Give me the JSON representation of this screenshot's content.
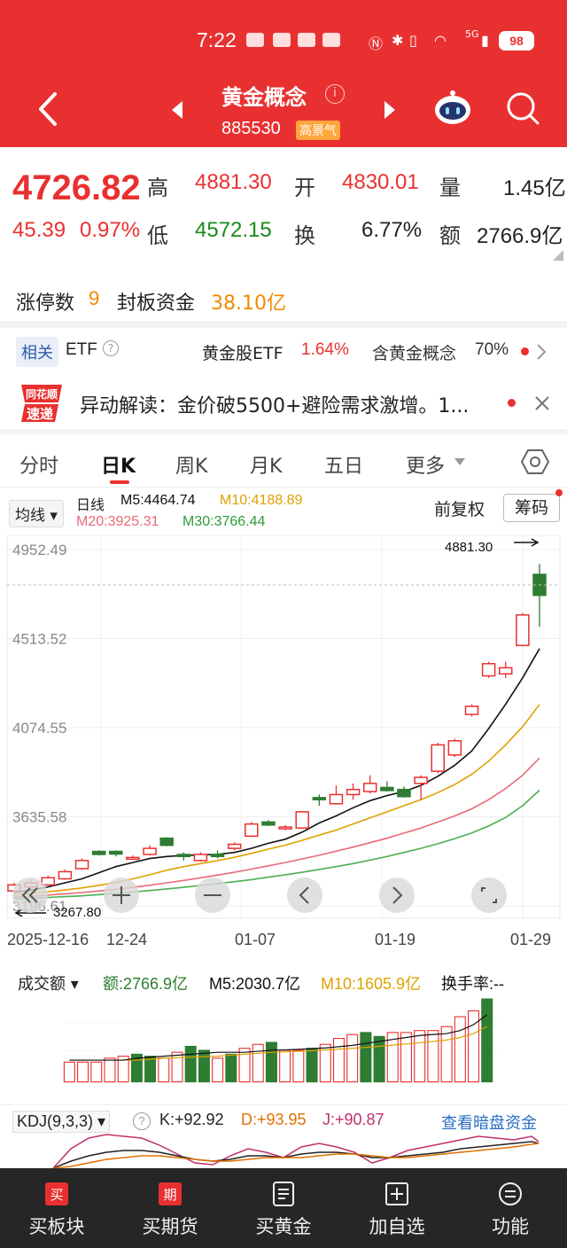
{
  "status_bar": {
    "time": "7:22",
    "signal": "5G",
    "battery": "98"
  },
  "header": {
    "title": "黄金概念",
    "code": "885530",
    "badge": "高景气"
  },
  "quote": {
    "price": "4726.82",
    "change": "45.39",
    "change_pct": "0.97%",
    "labels": {
      "high": "高",
      "low": "低",
      "open": "开",
      "turnover": "换",
      "volume": "量",
      "amount": "额"
    },
    "high": "4881.30",
    "low": "4572.15",
    "open": "4830.01",
    "turnover_rate": "6.77%",
    "volume": "1.45亿",
    "amount": "2766.9亿"
  },
  "limit_up": {
    "label": "涨停数",
    "count": "9",
    "seal_label": "封板资金",
    "seal_amount": "38.10亿"
  },
  "related": {
    "tag": "相关",
    "etf": "ETF",
    "gold_etf_name": "黄金股ETF",
    "gold_etf_pct": "1.64%",
    "contain_label": "含黄金概念",
    "contain_pct": "70%"
  },
  "news": {
    "logo_line1": "同花顺",
    "logo_line2": "速递",
    "text": "异动解读：金价破5500+避险需求激增。1..."
  },
  "tabs": [
    "分时",
    "日K",
    "周K",
    "月K",
    "五日",
    "更多"
  ],
  "ma": {
    "select": "均线",
    "kind": "日线",
    "m5": "M5:4464.74",
    "m10": "M10:4188.89",
    "m20": "M20:3925.31",
    "m30": "M30:3766.44",
    "adjust": "前复权",
    "chip_button": "筹码"
  },
  "price_axis": [
    "4952.49",
    "4513.52",
    "4074.55",
    "3635.58",
    "3196.61"
  ],
  "chart_high_label": "4881.30",
  "chart_low_label": "3267.80",
  "date_axis": [
    "2025-12-16",
    "12-24",
    "01-07",
    "01-19",
    "01-29"
  ],
  "volume_header": {
    "select": "成交额",
    "amount": "额:2766.9亿",
    "m5": "M5:2030.7亿",
    "m10": "M10:1605.9亿",
    "turnover": "换手率:--"
  },
  "kdj_header": {
    "select": "KDJ(9,3,3)",
    "k": "K:+92.92",
    "d": "D:+93.95",
    "j": "J:+90.87",
    "link": "查看暗盘资金"
  },
  "bottom_nav": [
    "买板块",
    "买期货",
    "买黄金",
    "加自选",
    "功能"
  ],
  "colors": {
    "red": "#e93030",
    "green": "#2e7d32",
    "ma5": "#111111",
    "ma10": "#e0a000",
    "ma20": "#e86a78",
    "ma30": "#4caf50"
  },
  "chart_data": {
    "type": "candlestick",
    "ylim": [
      3196.61,
      4952.49
    ],
    "dates": [
      "12-16",
      "12-17",
      "12-18",
      "12-19",
      "12-22",
      "12-23",
      "12-24",
      "12-25",
      "12-26",
      "12-29",
      "12-30",
      "12-31",
      "01-02",
      "01-05",
      "01-06",
      "01-07",
      "01-08",
      "01-09",
      "01-12",
      "01-13",
      "01-14",
      "01-15",
      "01-16",
      "01-19",
      "01-20",
      "01-21",
      "01-22",
      "01-23",
      "01-26",
      "01-27",
      "01-28",
      "01-29"
    ],
    "candles": [
      {
        "o": 3270,
        "c": 3300,
        "h": 3310,
        "l": 3268
      },
      {
        "o": 3290,
        "c": 3310,
        "h": 3320,
        "l": 3285
      },
      {
        "o": 3300,
        "c": 3335,
        "h": 3345,
        "l": 3295
      },
      {
        "o": 3330,
        "c": 3365,
        "h": 3375,
        "l": 3325
      },
      {
        "o": 3380,
        "c": 3420,
        "h": 3430,
        "l": 3375
      },
      {
        "o": 3465,
        "c": 3450,
        "h": 3470,
        "l": 3445
      },
      {
        "o": 3465,
        "c": 3452,
        "h": 3470,
        "l": 3440
      },
      {
        "o": 3430,
        "c": 3435,
        "h": 3445,
        "l": 3425
      },
      {
        "o": 3450,
        "c": 3480,
        "h": 3495,
        "l": 3445
      },
      {
        "o": 3530,
        "c": 3495,
        "h": 3535,
        "l": 3490
      },
      {
        "o": 3450,
        "c": 3440,
        "h": 3460,
        "l": 3420
      },
      {
        "o": 3420,
        "c": 3450,
        "h": 3460,
        "l": 3415
      },
      {
        "o": 3450,
        "c": 3440,
        "h": 3470,
        "l": 3430
      },
      {
        "o": 3480,
        "c": 3500,
        "h": 3510,
        "l": 3470
      },
      {
        "o": 3540,
        "c": 3600,
        "h": 3610,
        "l": 3535
      },
      {
        "o": 3610,
        "c": 3595,
        "h": 3620,
        "l": 3590
      },
      {
        "o": 3580,
        "c": 3585,
        "h": 3595,
        "l": 3570
      },
      {
        "o": 3580,
        "c": 3660,
        "h": 3665,
        "l": 3575
      },
      {
        "o": 3730,
        "c": 3720,
        "h": 3745,
        "l": 3690
      },
      {
        "o": 3700,
        "c": 3745,
        "h": 3790,
        "l": 3695
      },
      {
        "o": 3745,
        "c": 3770,
        "h": 3800,
        "l": 3720
      },
      {
        "o": 3760,
        "c": 3800,
        "h": 3840,
        "l": 3750
      },
      {
        "o": 3780,
        "c": 3765,
        "h": 3810,
        "l": 3760
      },
      {
        "o": 3770,
        "c": 3735,
        "h": 3785,
        "l": 3730
      },
      {
        "o": 3800,
        "c": 3830,
        "h": 3840,
        "l": 3720
      },
      {
        "o": 3860,
        "c": 3990,
        "h": 4000,
        "l": 3850
      },
      {
        "o": 3940,
        "c": 4010,
        "h": 4020,
        "l": 3930
      },
      {
        "o": 4140,
        "c": 4180,
        "h": 4190,
        "l": 4130
      },
      {
        "o": 4330,
        "c": 4390,
        "h": 4400,
        "l": 4320
      },
      {
        "o": 4340,
        "c": 4370,
        "h": 4400,
        "l": 4320
      },
      {
        "o": 4480,
        "c": 4630,
        "h": 4640,
        "l": 4475
      },
      {
        "o": 4830,
        "c": 4726.82,
        "h": 4881.3,
        "l": 4572.15
      }
    ],
    "ma5": [
      3262,
      3275,
      3290,
      3310,
      3330,
      3360,
      3390,
      3410,
      3430,
      3440,
      3445,
      3448,
      3450,
      3460,
      3480,
      3505,
      3525,
      3560,
      3605,
      3640,
      3680,
      3715,
      3740,
      3760,
      3790,
      3835,
      3890,
      3960,
      4070,
      4190,
      4320,
      4464.74
    ],
    "ma10": [
      3250,
      3258,
      3266,
      3275,
      3285,
      3298,
      3312,
      3330,
      3350,
      3372,
      3390,
      3405,
      3420,
      3436,
      3455,
      3476,
      3496,
      3520,
      3545,
      3570,
      3600,
      3630,
      3660,
      3690,
      3720,
      3755,
      3795,
      3845,
      3910,
      3990,
      4080,
      4188.89
    ],
    "ma20": [
      3240,
      3244,
      3250,
      3256,
      3262,
      3270,
      3278,
      3288,
      3298,
      3310,
      3322,
      3335,
      3348,
      3362,
      3378,
      3394,
      3410,
      3428,
      3446,
      3466,
      3486,
      3508,
      3530,
      3555,
      3580,
      3610,
      3640,
      3675,
      3720,
      3775,
      3840,
      3925.31
    ],
    "ma30": [
      3232,
      3234,
      3238,
      3242,
      3246,
      3252,
      3258,
      3265,
      3272,
      3280,
      3288,
      3297,
      3306,
      3316,
      3326,
      3338,
      3350,
      3362,
      3376,
      3390,
      3405,
      3422,
      3440,
      3460,
      3480,
      3503,
      3528,
      3556,
      3590,
      3632,
      3690,
      3766.44
    ],
    "amount": [
      1.0,
      1.0,
      1.0,
      1.2,
      1.3,
      1.4,
      1.3,
      1.2,
      1.5,
      1.8,
      1.6,
      1.2,
      1.4,
      1.7,
      1.9,
      2.0,
      1.6,
      1.6,
      1.7,
      1.9,
      2.2,
      2.4,
      2.5,
      2.3,
      2.5,
      2.5,
      2.6,
      2.6,
      2.8,
      3.3,
      3.6,
      4.2
    ],
    "amount_ma5": [
      1.1,
      1.1,
      1.1,
      1.1,
      1.1,
      1.2,
      1.25,
      1.3,
      1.35,
      1.4,
      1.45,
      1.5,
      1.5,
      1.5,
      1.55,
      1.6,
      1.62,
      1.65,
      1.68,
      1.72,
      1.78,
      1.85,
      1.95,
      2.05,
      2.15,
      2.25,
      2.35,
      2.4,
      2.45,
      2.6,
      2.9,
      3.4
    ],
    "amount_ma10": [
      1.1,
      1.1,
      1.1,
      1.1,
      1.1,
      1.1,
      1.15,
      1.2,
      1.22,
      1.25,
      1.28,
      1.3,
      1.35,
      1.4,
      1.45,
      1.5,
      1.52,
      1.55,
      1.58,
      1.62,
      1.66,
      1.7,
      1.75,
      1.8,
      1.86,
      1.92,
      1.98,
      2.05,
      2.12,
      2.25,
      2.45,
      2.8
    ],
    "amount_up": [
      true,
      true,
      true,
      true,
      true,
      false,
      false,
      true,
      true,
      false,
      false,
      true,
      false,
      true,
      true,
      false,
      true,
      true,
      false,
      true,
      true,
      true,
      false,
      false,
      true,
      true,
      true,
      true,
      true,
      true,
      true,
      false
    ]
  }
}
